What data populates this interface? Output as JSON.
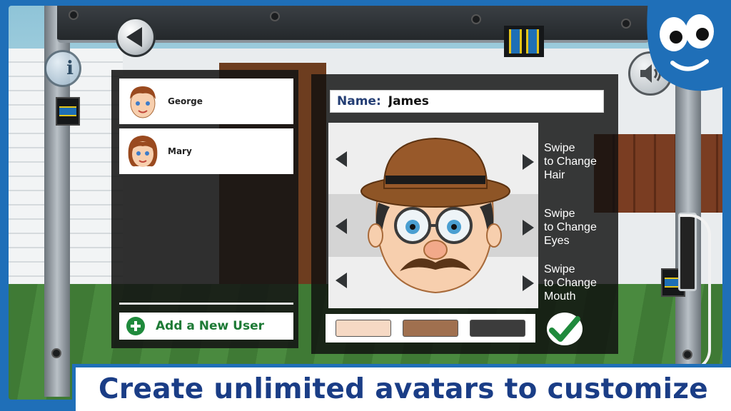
{
  "app": {
    "screen": "avatar-editor"
  },
  "controls": {
    "back_icon": "back-arrow-icon",
    "info_label": "i",
    "sound_icon": "speaker-icon"
  },
  "users": [
    {
      "name": "George",
      "avatar_icon": "boy-face-icon"
    },
    {
      "name": "Mary",
      "avatar_icon": "girl-face-icon"
    }
  ],
  "add_user": {
    "label": "Add a New User",
    "icon": "plus-circle-icon"
  },
  "editor": {
    "name_label": "Name:",
    "name_value": "James",
    "swipe_hints": [
      {
        "line1": "Swipe",
        "line2": "to Change",
        "line3": "Hair"
      },
      {
        "line1": "Swipe",
        "line2": "to Change",
        "line3": "Eyes"
      },
      {
        "line1": "Swipe",
        "line2": "to Change",
        "line3": "Mouth"
      }
    ],
    "skin_tones": [
      "#f6d9c4",
      "#a0704f",
      "#3c3c3c"
    ],
    "confirm_icon": "checkmark-icon"
  },
  "caption": "Create unlimited avatars to customize",
  "colors": {
    "brand_blue": "#1f6fb8",
    "caption_text": "#1a3d86",
    "add_green": "#1d7a35"
  }
}
